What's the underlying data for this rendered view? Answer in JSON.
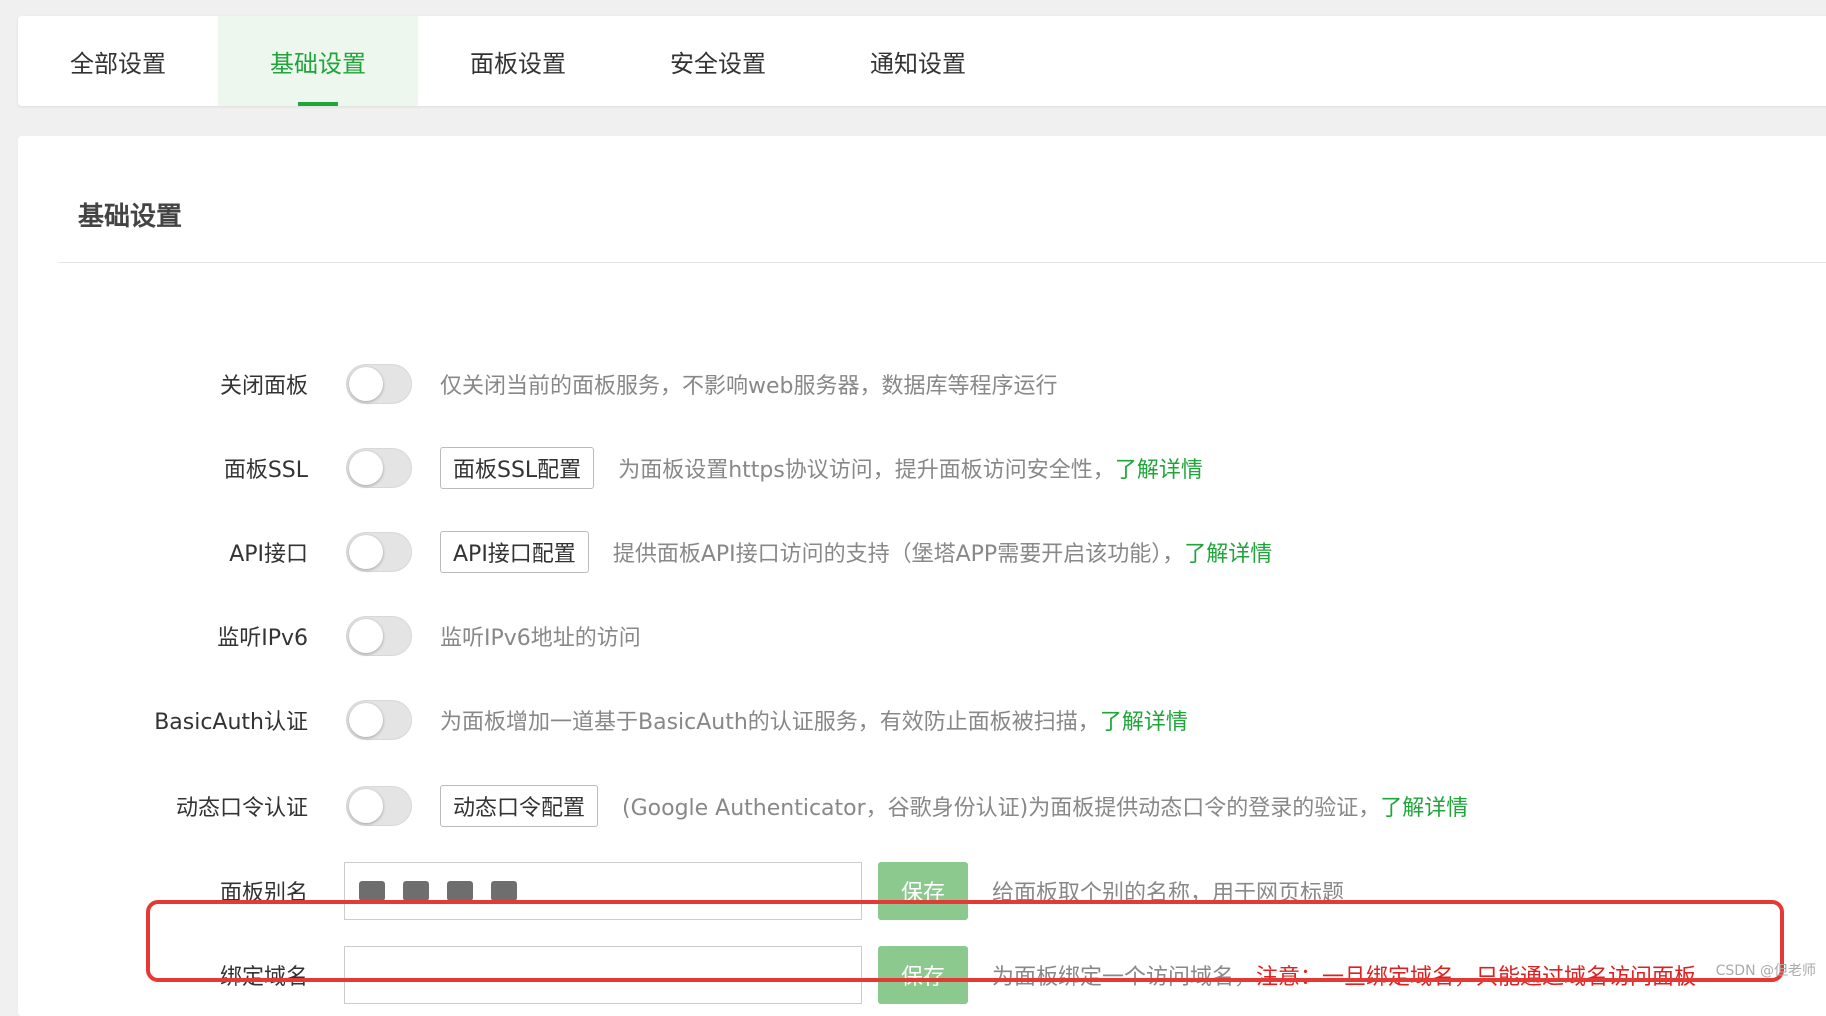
{
  "tabs": [
    {
      "label": "全部设置"
    },
    {
      "label": "基础设置",
      "active": true
    },
    {
      "label": "面板设置"
    },
    {
      "label": "安全设置"
    },
    {
      "label": "通知设置"
    }
  ],
  "section_title": "基础设置",
  "rows": {
    "close_panel": {
      "label": "关闭面板",
      "enabled": false,
      "desc": "仅关闭当前的面板服务，不影响web服务器，数据库等程序运行"
    },
    "panel_ssl": {
      "label": "面板SSL",
      "enabled": false,
      "button": "面板SSL配置",
      "desc": "为面板设置https协议访问，提升面板访问安全性，",
      "link": "了解详情"
    },
    "api": {
      "label": "API接口",
      "enabled": false,
      "button": "API接口配置",
      "desc": "提供面板API接口访问的支持（堡塔APP需要开启该功能），",
      "link": "了解详情"
    },
    "ipv6": {
      "label": "监听IPv6",
      "enabled": false,
      "desc": "监听IPv6地址的访问"
    },
    "basic_auth": {
      "label": "BasicAuth认证",
      "enabled": false,
      "desc": "为面板增加一道基于BasicAuth的认证服务，有效防止面板被扫描，",
      "link": "了解详情"
    },
    "otp": {
      "label": "动态口令认证",
      "enabled": false,
      "button": "动态口令配置",
      "desc": "(Google Authenticator，谷歌身份认证)为面板提供动态口令的登录的验证，",
      "link": "了解详情"
    },
    "alias": {
      "label": "面板别名",
      "value": "",
      "save": "保存",
      "desc": "给面板取个别的名称，用于网页标题"
    },
    "domain": {
      "label": "绑定域名",
      "value": "",
      "save": "保存",
      "desc": "为面板绑定一个访问域名，",
      "warn": "注意：一旦绑定域名，只能通过域名访问面板"
    }
  },
  "watermark": "CSDN @但老师",
  "colors": {
    "accent": "#20a53a",
    "save_button": "#8bc98f",
    "warning": "#e02020",
    "highlight_border": "#e53935"
  }
}
